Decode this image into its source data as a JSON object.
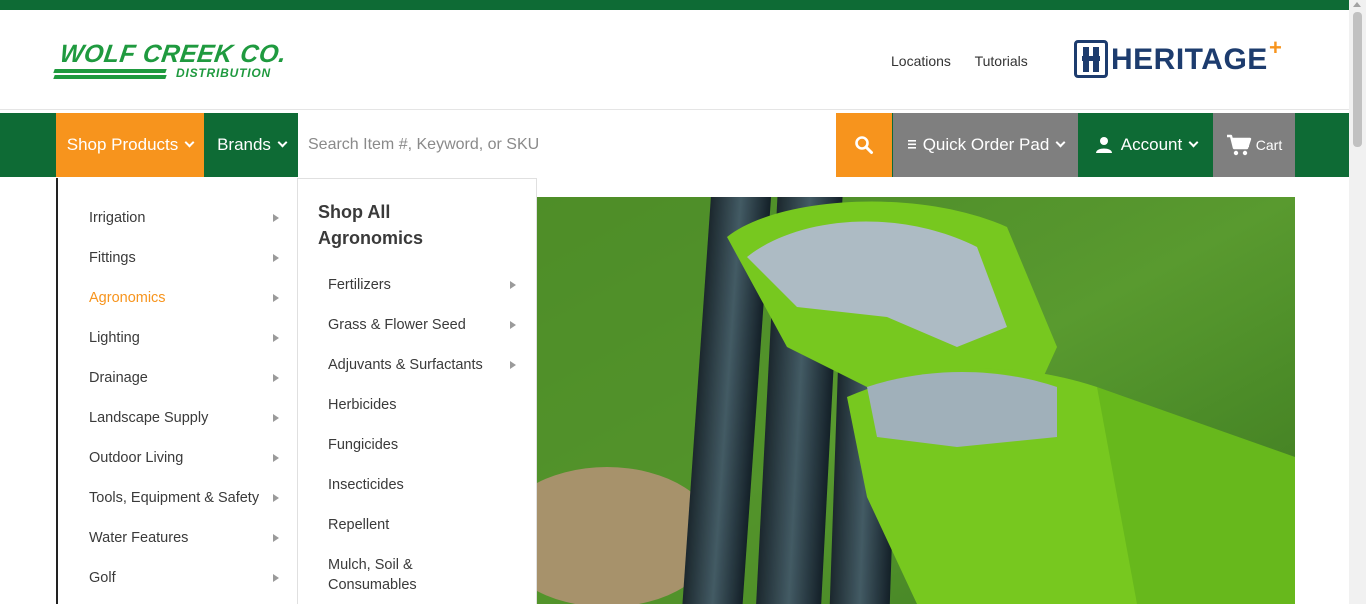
{
  "header": {
    "logo_left": {
      "line1": "WOLF CREEK CO.",
      "line2": "DISTRIBUTION"
    },
    "links": [
      "Locations",
      "Tutorials"
    ],
    "logo_right": {
      "text": "HERITAGE",
      "mark": "+"
    }
  },
  "nav": {
    "shop_products": "Shop Products",
    "brands": "Brands",
    "search_placeholder": "Search Item #, Keyword, or SKU",
    "quick_order_pad": "Quick Order Pad",
    "account": "Account",
    "cart": "Cart",
    "colors": {
      "green": "#0e6b35",
      "orange": "#f7941d",
      "gray": "#7f7f7f"
    }
  },
  "menu": {
    "categories": [
      {
        "label": "Irrigation"
      },
      {
        "label": "Fittings"
      },
      {
        "label": "Agronomics",
        "active": true
      },
      {
        "label": "Lighting"
      },
      {
        "label": "Drainage"
      },
      {
        "label": "Landscape Supply"
      },
      {
        "label": "Outdoor Living"
      },
      {
        "label": "Tools, Equipment & Safety"
      },
      {
        "label": "Water Features"
      },
      {
        "label": "Golf"
      }
    ],
    "sub_heading": "Shop All Agronomics",
    "sub_items": [
      {
        "label": "Fertilizers",
        "has_children": true
      },
      {
        "label": "Grass & Flower Seed",
        "has_children": true
      },
      {
        "label": "Adjuvants & Surfactants",
        "has_children": true
      },
      {
        "label": "Herbicides"
      },
      {
        "label": "Fungicides"
      },
      {
        "label": "Insecticides"
      },
      {
        "label": "Repellent"
      },
      {
        "label": "Mulch, Soil & Consumables"
      }
    ]
  },
  "hero": {
    "icon": "gloved-hands-holding-pipes-image"
  }
}
